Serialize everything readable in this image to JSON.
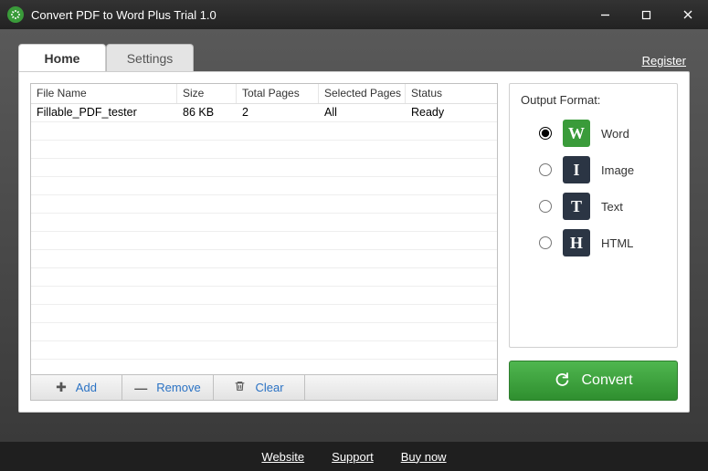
{
  "titlebar": {
    "title": "Convert PDF to Word Plus Trial 1.0"
  },
  "tabs": {
    "home": "Home",
    "settings": "Settings"
  },
  "register_link": "Register",
  "table": {
    "headers": {
      "file": "File Name",
      "size": "Size",
      "pages": "Total Pages",
      "selected": "Selected Pages",
      "status": "Status"
    },
    "rows": [
      {
        "file": "Fillable_PDF_tester",
        "size": "86 KB",
        "pages": "2",
        "selected": "All",
        "status": "Ready"
      }
    ]
  },
  "toolbar": {
    "add": "Add",
    "remove": "Remove",
    "clear": "Clear"
  },
  "output": {
    "title": "Output Format:",
    "options": {
      "word": {
        "label": "Word",
        "glyph": "W",
        "selected": true
      },
      "image": {
        "label": "Image",
        "glyph": "I",
        "selected": false
      },
      "text": {
        "label": "Text",
        "glyph": "T",
        "selected": false
      },
      "html": {
        "label": "HTML",
        "glyph": "H",
        "selected": false
      }
    }
  },
  "convert_label": "Convert",
  "footer": {
    "website": "Website",
    "support": "Support",
    "buy": "Buy now"
  }
}
